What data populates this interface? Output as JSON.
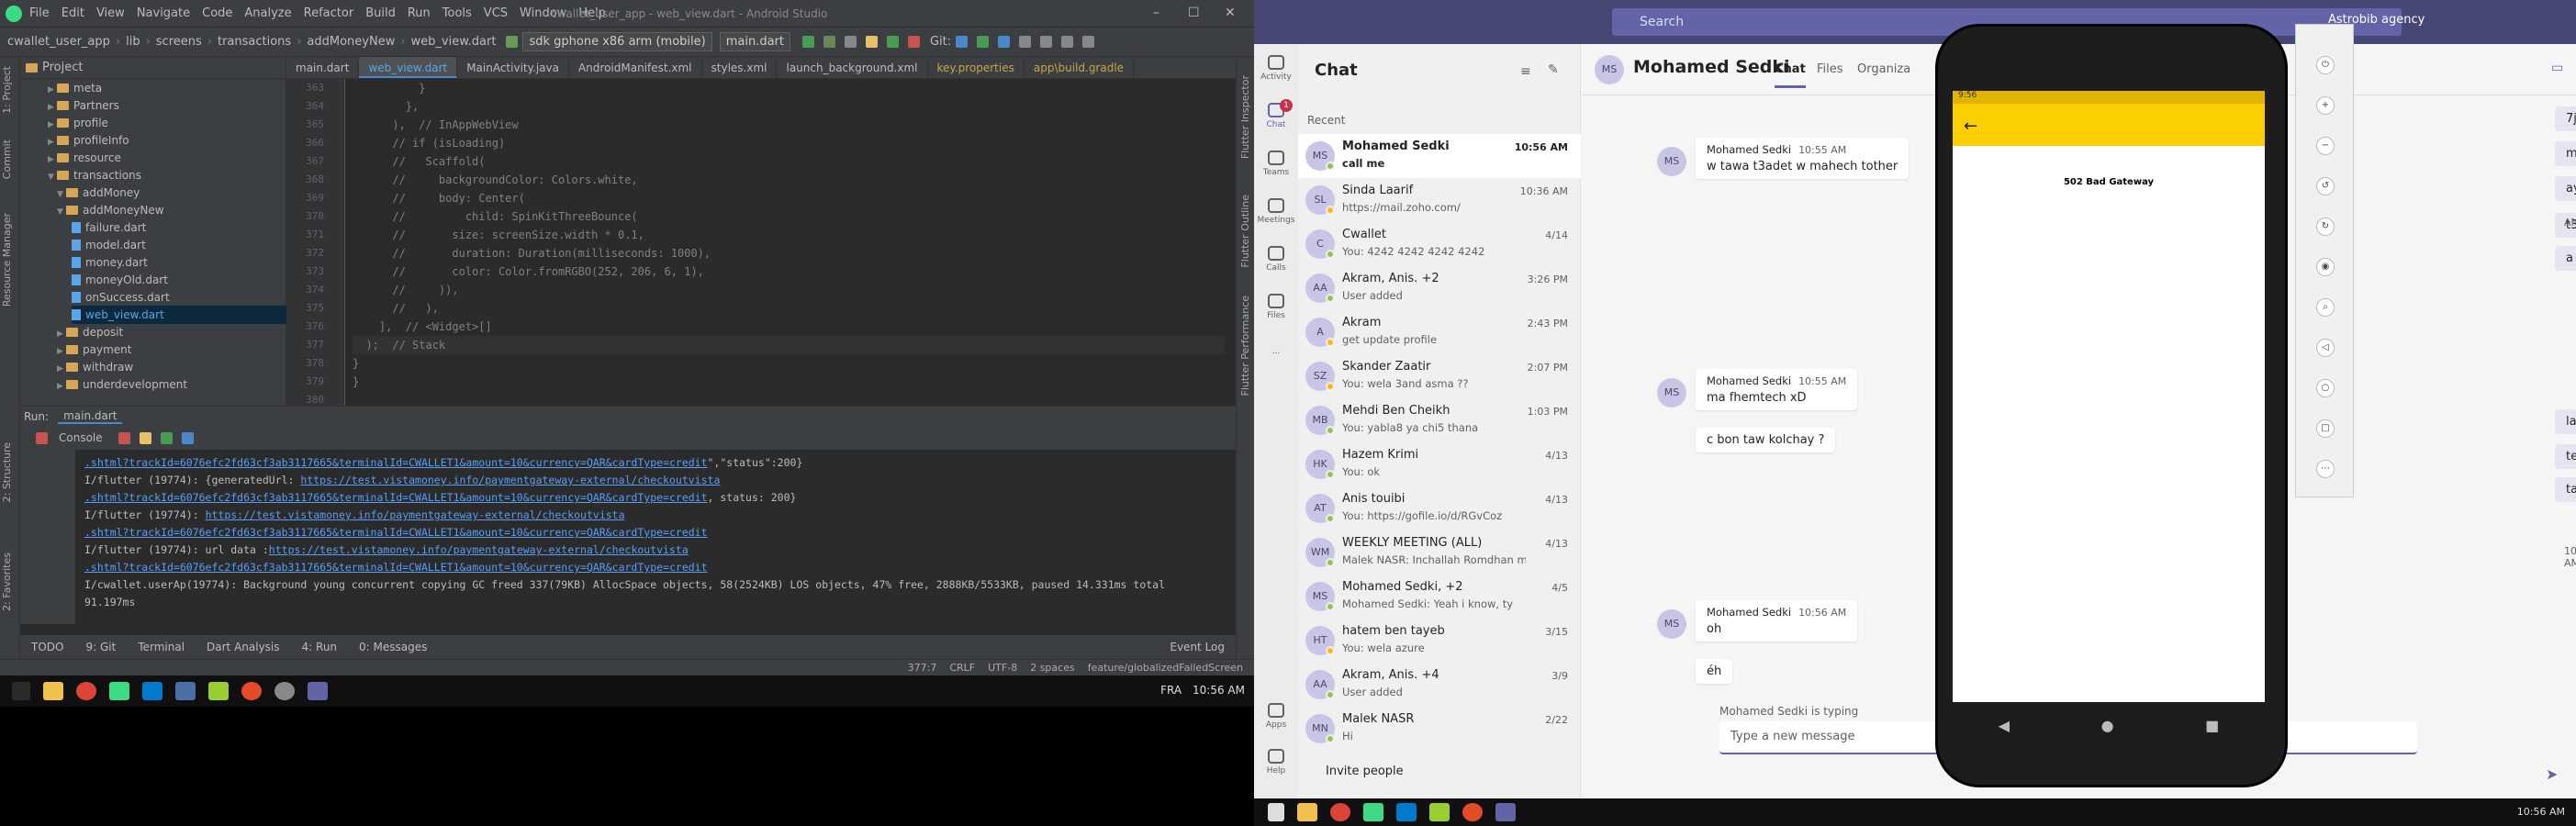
{
  "android_studio": {
    "window_title": "cwallet_user_app - web_view.dart - Android Studio",
    "menu": [
      "File",
      "Edit",
      "View",
      "Navigate",
      "Code",
      "Analyze",
      "Refactor",
      "Build",
      "Run",
      "Tools",
      "VCS",
      "Window",
      "Help"
    ],
    "breadcrumbs": [
      "cwallet_user_app",
      "lib",
      "screens",
      "transactions",
      "addMoneyNew",
      "web_view.dart"
    ],
    "device": "sdk gphone x86 arm (mobile)",
    "run_config": "main.dart",
    "git_label": "Git:",
    "project_label": "Project",
    "tree": [
      {
        "name": "meta",
        "type": "folder"
      },
      {
        "name": "Partners",
        "type": "folder"
      },
      {
        "name": "profile",
        "type": "folder"
      },
      {
        "name": "profileInfo",
        "type": "folder"
      },
      {
        "name": "resource",
        "type": "folder"
      },
      {
        "name": "transactions",
        "type": "folder"
      },
      {
        "name": "addMoney",
        "type": "folder"
      },
      {
        "name": "addMoneyNew",
        "type": "folder"
      },
      {
        "name": "failure.dart",
        "type": "file"
      },
      {
        "name": "model.dart",
        "type": "file"
      },
      {
        "name": "money.dart",
        "type": "file"
      },
      {
        "name": "moneyOld.dart",
        "type": "file"
      },
      {
        "name": "onSuccess.dart",
        "type": "file"
      },
      {
        "name": "web_view.dart",
        "type": "file"
      },
      {
        "name": "deposit",
        "type": "folder"
      },
      {
        "name": "payment",
        "type": "folder"
      },
      {
        "name": "withdraw",
        "type": "folder"
      },
      {
        "name": "underdevelopment",
        "type": "folder"
      }
    ],
    "tabs": [
      "main.dart",
      "web_view.dart",
      "MainActivity.java",
      "AndroidManifest.xml",
      "styles.xml",
      "launch_background.xml",
      "key.properties",
      "app\\build.gradle"
    ],
    "code_lines": [
      {
        "n": "363",
        "text": "          }"
      },
      {
        "n": "364",
        "text": "        },"
      },
      {
        "n": "365",
        "text": "      ),  // InAppWebView"
      },
      {
        "n": "366",
        "text": "      // if (isLoading)"
      },
      {
        "n": "367",
        "text": "      //   Scaffold("
      },
      {
        "n": "368",
        "text": "      //     backgroundColor: Colors.white,"
      },
      {
        "n": "369",
        "text": "      //     body: Center("
      },
      {
        "n": "370",
        "text": "      //         child: SpinKitThreeBounce("
      },
      {
        "n": "371",
        "text": "      //       size: screenSize.width * 0.1,"
      },
      {
        "n": "372",
        "text": "      //       duration: Duration(milliseconds: 1000),"
      },
      {
        "n": "373",
        "text": "      //       color: Color.fromRGBO(252, 206, 6, 1),"
      },
      {
        "n": "374",
        "text": "      //     )),"
      },
      {
        "n": "375",
        "text": "      //   ),"
      },
      {
        "n": "376",
        "text": "    ],  // <Widget>[]"
      },
      {
        "n": "377",
        "text": "  );  // Stack"
      },
      {
        "n": "378",
        "text": "}"
      },
      {
        "n": "379",
        "text": "}"
      },
      {
        "n": "380",
        "text": ""
      }
    ],
    "run_label": "Run:",
    "run_tab": "main.dart",
    "console_label": "Console",
    "console_lines": [
      {
        "pre": "",
        "link": ".shtml?trackId=6076efc2fd63cf3ab3117665&terminalId=CWALLET1&amount=10&currency=QAR&cardType=credit",
        "post": "\",\"status\":200}"
      },
      {
        "pre": "I/flutter (19774): {generatedUrl: ",
        "link": "https://test.vistamoney.info/paymentgateway-external/checkoutvista",
        "post": ""
      },
      {
        "pre": "",
        "link": ".shtml?trackId=6076efc2fd63cf3ab3117665&terminalId=CWALLET1&amount=10&currency=QAR&cardType=credit",
        "post": ", status: 200}"
      },
      {
        "pre": "I/flutter (19774): ",
        "link": "https://test.vistamoney.info/paymentgateway-external/checkoutvista",
        "post": ""
      },
      {
        "pre": "",
        "link": ".shtml?trackId=6076efc2fd63cf3ab3117665&terminalId=CWALLET1&amount=10&currency=QAR&cardType=credit",
        "post": ""
      },
      {
        "pre": "I/flutter (19774): url data :",
        "link": "https://test.vistamoney.info/paymentgateway-external/checkoutvista",
        "post": ""
      },
      {
        "pre": "",
        "link": ".shtml?trackId=6076efc2fd63cf3ab3117665&terminalId=CWALLET1&amount=10&currency=QAR&cardType=credit",
        "post": ""
      },
      {
        "pre": "I/cwallet.userAp(19774): Background young concurrent copying GC freed 337(79KB) AllocSpace objects, 58(2524KB) LOS objects, 47% free, 2888KB/5533KB, paused 14.331ms total",
        "link": "",
        "post": ""
      },
      {
        "pre": "  91.197ms",
        "link": "",
        "post": ""
      }
    ],
    "bottom_tabs": [
      "TODO",
      "9: Git",
      "Terminal",
      "Dart Analysis",
      "4: Run",
      "0: Messages"
    ],
    "event_log": "Event Log",
    "status_items": [
      "377:7",
      "CRLF",
      "UTF-8",
      "2 spaces",
      "feature/globalizedFailedScreen"
    ],
    "left_vtabs": [
      "1: Project",
      "Commit",
      "Resource Manager",
      "2: Structure",
      "2: Favorites"
    ],
    "right_vtabs": [
      "Flutter Inspector",
      "Flutter Outline",
      "Flutter Performance"
    ]
  },
  "taskbar_left": {
    "lang": "FRA",
    "time": "10:56 AM"
  },
  "teams": {
    "search_placeholder": "Search",
    "account": "Astrobib agency",
    "rail": [
      {
        "label": "Activity",
        "badge": ""
      },
      {
        "label": "Chat",
        "badge": "1"
      },
      {
        "label": "Teams",
        "badge": ""
      },
      {
        "label": "Meetings",
        "badge": ""
      },
      {
        "label": "Calls",
        "badge": ""
      },
      {
        "label": "Files",
        "badge": ""
      },
      {
        "label": "...",
        "badge": ""
      },
      {
        "label": "Apps",
        "badge": ""
      },
      {
        "label": "Help",
        "badge": ""
      }
    ],
    "list_title": "Chat",
    "recent_label": "Recent",
    "conversations": [
      {
        "initials": "MS",
        "name": "Mohamed Sedki",
        "preview": "call me",
        "time": "10:56 AM",
        "selected": true,
        "status": "online"
      },
      {
        "initials": "SL",
        "name": "Sinda Laarif",
        "preview": "https://mail.zoho.com/",
        "time": "10:36 AM",
        "selected": false,
        "status": "away"
      },
      {
        "initials": "C",
        "name": "Cwallet",
        "preview": "You: 4242 4242 4242 4242",
        "time": "4/14",
        "selected": false,
        "status": "online"
      },
      {
        "initials": "AA",
        "name": "Akram, Anis. +2",
        "preview": "User added",
        "time": "3:26 PM",
        "selected": false,
        "status": "online"
      },
      {
        "initials": "A",
        "name": "Akram",
        "preview": "get update profile",
        "time": "2:43 PM",
        "selected": false,
        "status": "away"
      },
      {
        "initials": "SZ",
        "name": "Skander Zaatir",
        "preview": "You: wela 3and asma ??",
        "time": "2:07 PM",
        "selected": false,
        "status": "away"
      },
      {
        "initials": "MB",
        "name": "Mehdi Ben Cheikh",
        "preview": "You: yabla8 ya chi5 thana",
        "time": "1:03 PM",
        "selected": false,
        "status": "online"
      },
      {
        "initials": "HK",
        "name": "Hazem Krimi",
        "preview": "You: ok",
        "time": "4/13",
        "selected": false,
        "status": "online"
      },
      {
        "initials": "AT",
        "name": "Anis touibi",
        "preview": "You: https://gofile.io/d/RGvCoz",
        "time": "4/13",
        "selected": false,
        "status": "online"
      },
      {
        "initials": "WM",
        "name": "WEEKLY MEETING (ALL)",
        "preview": "Malek NASR: Inchallah Romdhan moubar...",
        "time": "4/13",
        "selected": false,
        "status": "online"
      },
      {
        "initials": "MS",
        "name": "Mohamed Sedki, +2",
        "preview": "Mohamed Sedki: Yeah i know, ty",
        "time": "4/5",
        "selected": false,
        "status": "online"
      },
      {
        "initials": "HT",
        "name": "hatem ben tayeb",
        "preview": "You: wela azure",
        "time": "3/15",
        "selected": false,
        "status": "away"
      },
      {
        "initials": "AA",
        "name": "Akram, Anis. +4",
        "preview": "User added",
        "time": "3/9",
        "selected": false,
        "status": "online"
      },
      {
        "initials": "MN",
        "name": "Malek NASR",
        "preview": "Hi",
        "time": "2/22",
        "selected": false,
        "status": "online"
      }
    ],
    "invite": "Invite people",
    "chat_title": "Mohamed Sedki",
    "chat_avatar": "MS",
    "chat_tabs": [
      "Chat",
      "Files",
      "Organiza"
    ],
    "messages": [
      {
        "author": "Mohamed Sedki",
        "time": "10:55 AM",
        "lines": [
          "w tawa t3adet w mahech tother"
        ]
      },
      {
        "author": "Mohamed Sedki",
        "time": "10:55 AM",
        "lines": [
          "ma fhemtech xD",
          "c bon taw kolchay ?"
        ]
      },
      {
        "author": "Mohamed Sedki",
        "time": "10:56 AM",
        "lines": [
          "oh",
          "éh"
        ]
      }
    ],
    "my_messages": [
      "7jat o5ra",
      "main activt",
      "ay",
      "t3adet",
      "a kan tloadi",
      "la",
      "temchi el app",
      "taw"
    ],
    "my_time": "10:56 AM",
    "my_time_label": "AM",
    "reactions": [
      "👍",
      "❤",
      "😆",
      "😮",
      "😢",
      "😠",
      "···"
    ],
    "typing": "Mohamed Sedki is typing",
    "compose_placeholder": "Type a new message"
  },
  "emulator": {
    "status_time": "9:56",
    "page_message": "502 Bad Gateway",
    "accent": "#fcd000"
  },
  "taskbar_right": {
    "time": "10:56 AM"
  }
}
